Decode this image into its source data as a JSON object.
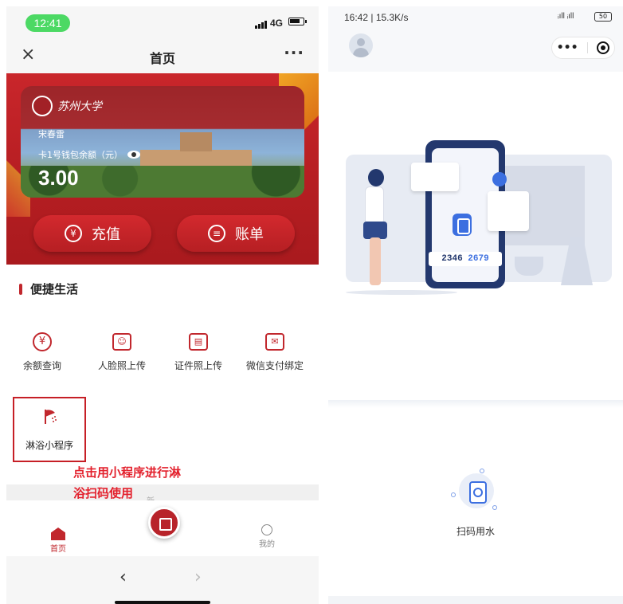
{
  "left_phone": {
    "status": {
      "time": "12:41",
      "network": "4G"
    },
    "nav": {
      "close_glyph": "×",
      "title": "首页",
      "more_glyph": "···"
    },
    "card": {
      "logo_text": "苏州大学",
      "holder_name": "宋春雷",
      "balance_label": "卡1号钱包余额（元）",
      "balance": "3.00"
    },
    "actions": {
      "recharge": "充值",
      "bill": "账单"
    },
    "section": {
      "title": "便捷生活",
      "features": [
        {
          "label": "余额查询",
          "icon": "yuan-circle-icon",
          "glyph": "¥"
        },
        {
          "label": "人脸照上传",
          "icon": "face-scan-icon",
          "glyph": "☺"
        },
        {
          "label": "证件照上传",
          "icon": "id-card-icon",
          "glyph": "▤"
        },
        {
          "label": "微信支付绑定",
          "icon": "wechat-bind-icon",
          "glyph": "✉"
        }
      ],
      "shower": {
        "label": "淋浴小程序",
        "icon": "shower-icon"
      }
    },
    "annotation": {
      "line1": "点击用小程序进行淋",
      "line2": "浴扫码使用"
    },
    "ghost_text": "新",
    "tabbar": {
      "home": "首页",
      "mine": "我的"
    },
    "sysnav": {
      "back": "‹",
      "forward": "›"
    }
  },
  "right_phone": {
    "status": {
      "time_speed": "16:42 | 15.3K/s",
      "signal": "ᵢıll ᵢıll",
      "battery": "50"
    },
    "illustration": {
      "num_a": "2346",
      "num_b": "2679"
    },
    "scan": {
      "label": "扫码用水",
      "icon": "water-meter-scan-icon"
    }
  },
  "colors": {
    "brand_red": "#c1272d",
    "accent_blue": "#3c6fe0",
    "annotation_red": "#e3212d"
  }
}
